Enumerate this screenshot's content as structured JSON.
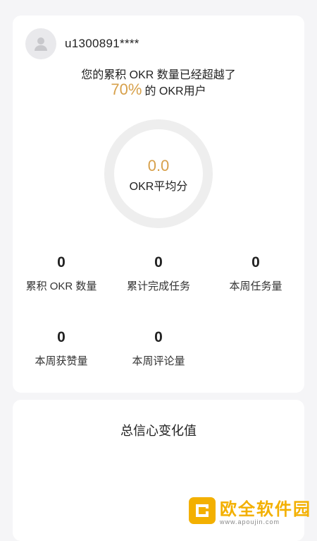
{
  "user": {
    "name": "u1300891****"
  },
  "summary": {
    "headline": "您的累积 OKR 数量已经超越了",
    "percent": "70%",
    "suffix": "的 OKR用户"
  },
  "score": {
    "value": "0.0",
    "label": "OKR平均分"
  },
  "stats": [
    {
      "value": "0",
      "label": "累积 OKR 数量"
    },
    {
      "value": "0",
      "label": "累计完成任务"
    },
    {
      "value": "0",
      "label": "本周任务量"
    },
    {
      "value": "0",
      "label": "本周获赞量"
    },
    {
      "value": "0",
      "label": "本周评论量"
    }
  ],
  "confidence": {
    "title": "总信心变化值"
  },
  "colors": {
    "accent": "#d7a04a",
    "ring": "#eeeeee",
    "background": "#f5f5f7"
  },
  "watermark": {
    "name": "欧全软件园",
    "url": "www.apoujin.com"
  }
}
